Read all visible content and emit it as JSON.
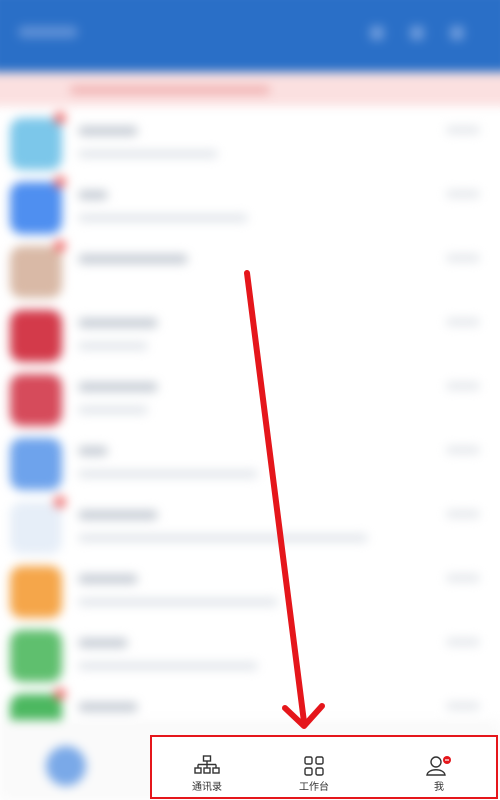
{
  "tab_bar": {
    "items": [
      {
        "label": "通讯录",
        "icon": "org-chart-icon"
      },
      {
        "label": "工作台",
        "icon": "grid-icon"
      },
      {
        "label": "我",
        "icon": "user-icon"
      }
    ]
  },
  "colors": {
    "header": "#2a6fc7",
    "highlight_border": "#e5161b",
    "arrow": "#e5161b"
  }
}
